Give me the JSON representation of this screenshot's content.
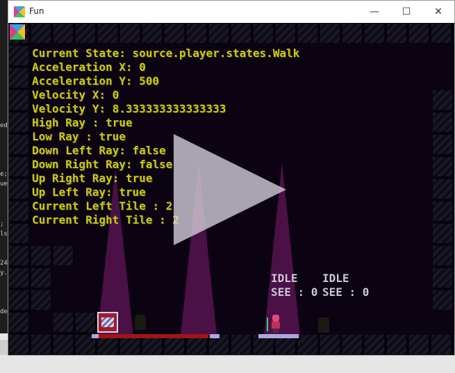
{
  "window": {
    "title": "Fun",
    "controls": {
      "minimize": "—",
      "maximize": "☐",
      "close": "✕"
    }
  },
  "hud": {
    "lines": [
      "Current State: source.player.states.Walk",
      "Acceleration X: 0",
      "Acceleration Y: 500",
      "Velocity X: 0",
      "Velocity Y: 8.333333333333333",
      "High Ray : true",
      "Low Ray : true",
      "Down Left Ray: false",
      "Down Right Ray: false",
      "Up Right Ray: true",
      "Up Left Ray: true",
      "Current Left Tile : 2",
      "Current Right Tile : 2"
    ]
  },
  "npcs": [
    {
      "state": "IDLE",
      "see": "SEE : 0"
    },
    {
      "state": "IDLE",
      "see": "SEE : 0"
    }
  ],
  "colors": {
    "hud_text": "#c9c81a",
    "spotlight": "#4b1046",
    "background": "#0b0212"
  },
  "editor_fragments": [
    "ed",
    "e;",
    "ue",
    ";",
    "ls",
    "24",
    "y.",
    "de"
  ]
}
